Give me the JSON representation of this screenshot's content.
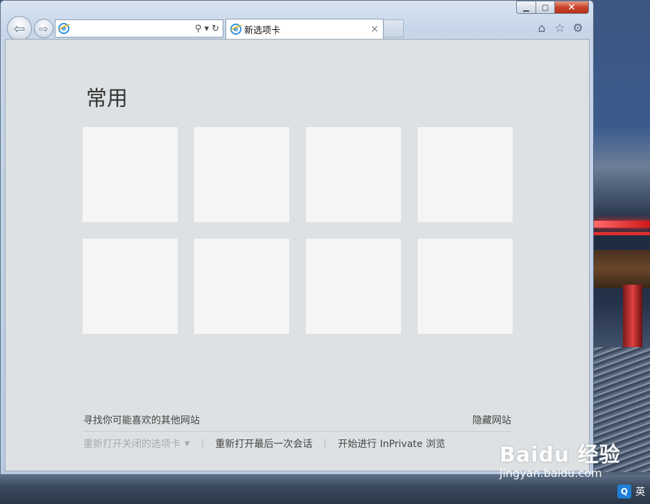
{
  "tab": {
    "title": "新选项卡",
    "close": "×"
  },
  "address": {
    "value": "",
    "search": "⚲",
    "dropdown": "▾",
    "refresh": "↻"
  },
  "window_controls": {
    "minimize": "▁",
    "maximize": "▢",
    "close": "✕"
  },
  "toolbar_icons": {
    "home": "⌂",
    "favorites": "☆",
    "tools": "⚙"
  },
  "page": {
    "heading": "常用",
    "tile_count": 8,
    "find_more": "寻找你可能喜欢的其他网站",
    "hide_sites": "隐藏网站",
    "reopen_closed": "重新打开关闭的选项卡",
    "reopen_closed_caret": "▼",
    "reopen_session": "重新打开最后一次会话",
    "inprivate": "开始进行 InPrivate 浏览",
    "separator": "|"
  },
  "watermark": {
    "brand": "Baidu 经验",
    "url": "jingyan.baidu.com"
  },
  "tray": {
    "input_method": "英",
    "app": "Q"
  },
  "colors": {
    "page_bg": "#dee1e3",
    "tile_bg": "#f5f5f5",
    "close_red": "#c8452a"
  }
}
